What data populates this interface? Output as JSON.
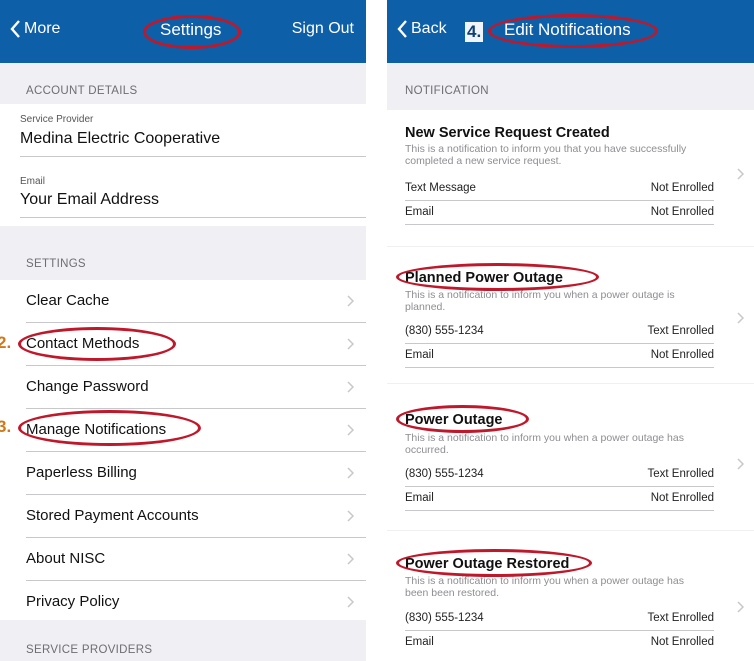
{
  "settings": {
    "nav": {
      "back_label": "More",
      "title": "Settings",
      "right_label": "Sign Out"
    },
    "account_header": "ACCOUNT DETAILS",
    "provider": {
      "label": "Service Provider",
      "value": "Medina Electric Cooperative"
    },
    "email": {
      "label": "Email",
      "value": "Your Email Address"
    },
    "settings_header": "SETTINGS",
    "items": [
      {
        "label": "Clear Cache"
      },
      {
        "label": "Contact Methods",
        "step": "2."
      },
      {
        "label": "Change Password"
      },
      {
        "label": "Manage Notifications",
        "step": "3."
      },
      {
        "label": "Paperless Billing"
      },
      {
        "label": "Stored Payment Accounts"
      },
      {
        "label": "About NISC"
      },
      {
        "label": "Privacy Policy"
      }
    ],
    "providers_header": "SERVICE PROVIDERS"
  },
  "notifications": {
    "nav": {
      "back_label": "Back",
      "title": "Edit Notifications",
      "step": "4."
    },
    "header": "NOTIFICATION",
    "cards": [
      {
        "title": "New Service Request Created",
        "description": "This is a notification to inform you that you have successfully completed a new service request.",
        "rows": [
          {
            "label": "Text Message",
            "status": "Not Enrolled"
          },
          {
            "label": "Email",
            "status": "Not Enrolled"
          }
        ]
      },
      {
        "title": "Planned Power Outage",
        "description": "This is a notification to inform you when a power outage is planned.",
        "rows": [
          {
            "label": "(830) 555-1234",
            "status": "Text Enrolled"
          },
          {
            "label": "Email",
            "status": "Not Enrolled"
          }
        ]
      },
      {
        "title": "Power Outage",
        "description": "This is a notification to inform you when a power outage has occurred.",
        "rows": [
          {
            "label": "(830) 555-1234",
            "status": "Text Enrolled"
          },
          {
            "label": "Email",
            "status": "Not Enrolled"
          }
        ]
      },
      {
        "title": "Power Outage Restored",
        "description": "This is a notification to inform you when a power outage has been been restored.",
        "rows": [
          {
            "label": "(830) 555-1234",
            "status": "Text Enrolled"
          },
          {
            "label": "Email",
            "status": "Not Enrolled"
          }
        ]
      }
    ]
  },
  "colors": {
    "nav_bar": "#0d5fa8",
    "highlight": "#c0182b",
    "step_number": "#d07818",
    "background": "#efeff4"
  }
}
